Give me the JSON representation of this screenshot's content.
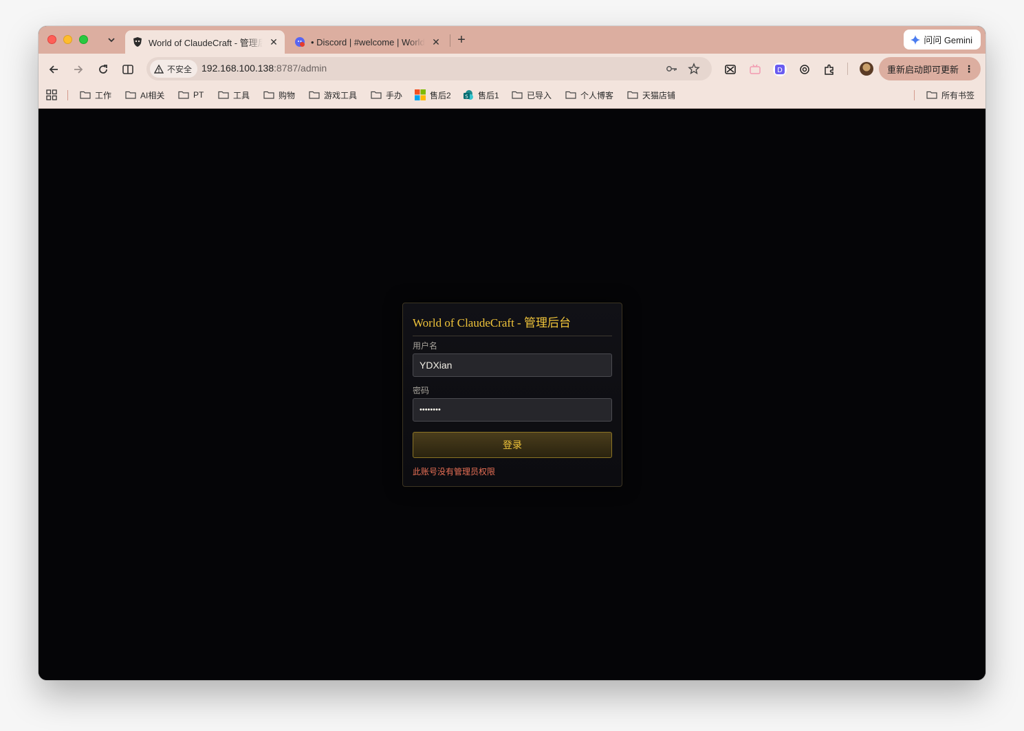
{
  "tabs": [
    {
      "title": "World of ClaudeCraft - 管理后台",
      "favicon": "shield-skull-icon",
      "active": true
    },
    {
      "title": "• Discord | #welcome | World of ClaudeCraft",
      "favicon": "discord-icon",
      "active": false
    }
  ],
  "gemini": {
    "label": "问问 Gemini"
  },
  "address_bar": {
    "security_label": "不安全",
    "url_host": "192.168.100.138",
    "url_path": ":8787/admin"
  },
  "update_button": {
    "label": "重新启动即可更新"
  },
  "bookmarks": [
    {
      "label": "工作",
      "icon": "folder-icon"
    },
    {
      "label": "AI相关",
      "icon": "folder-icon"
    },
    {
      "label": "PT",
      "icon": "folder-icon"
    },
    {
      "label": "工具",
      "icon": "folder-icon"
    },
    {
      "label": "购物",
      "icon": "folder-icon"
    },
    {
      "label": "游戏工具",
      "icon": "folder-icon"
    },
    {
      "label": "手办",
      "icon": "folder-icon"
    },
    {
      "label": "售后2",
      "icon": "microsoft-icon"
    },
    {
      "label": "售后1",
      "icon": "sharepoint-icon"
    },
    {
      "label": "已导入",
      "icon": "folder-icon"
    },
    {
      "label": "个人博客",
      "icon": "folder-icon"
    },
    {
      "label": "天猫店铺",
      "icon": "folder-icon"
    }
  ],
  "all_bookmarks": {
    "label": "所有书签"
  },
  "login": {
    "title": "World of ClaudeCraft - 管理后台",
    "username_label": "用户名",
    "username_value": "YDXian",
    "password_label": "密码",
    "password_value": "••••••••",
    "submit_label": "登录",
    "error_message": "此账号没有管理员权限"
  },
  "colors": {
    "accent_gold": "#f0c43a",
    "error": "#e86f55",
    "background": "#050507",
    "tabstrip": "#dcaea0"
  }
}
